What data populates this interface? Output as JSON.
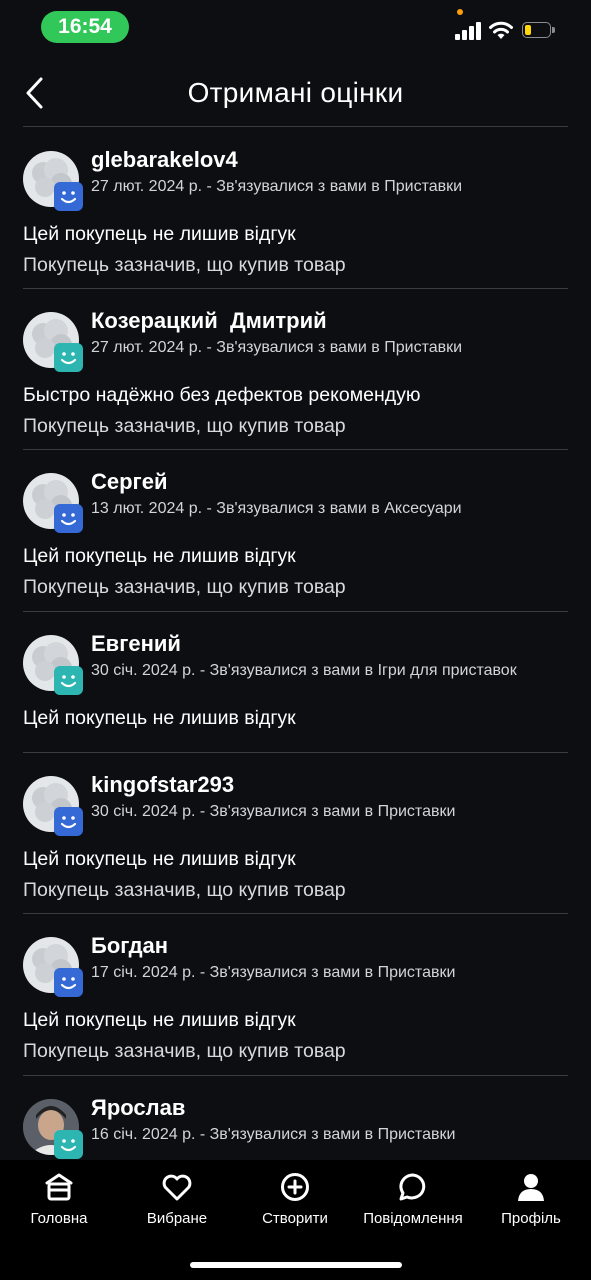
{
  "status_bar": {
    "time": "16:54"
  },
  "header": {
    "title": "Отримані оцінки"
  },
  "reviews": [
    {
      "name": "glebarakelov4",
      "date": "27 лют. 2024 р.",
      "context": " - Зв'язувалися з вами в Приставки",
      "comment": "Цей покупець не лишив відгук",
      "purchase": "Покупець зазначив, що купив товар"
    },
    {
      "name": "Козерацкий  Дмитрий",
      "date": "27 лют. 2024 р.",
      "context": " - Зв'язувалися з вами в Приставки",
      "comment": "Быстро надёжно без дефектов рекомендую",
      "purchase": "Покупець зазначив, що купив товар"
    },
    {
      "name": "Сергей",
      "date": "13 лют. 2024 р.",
      "context": " - Зв'язувалися з вами в Аксесуари",
      "comment": "Цей покупець не лишив відгук",
      "purchase": "Покупець зазначив, що купив товар"
    },
    {
      "name": "Евгений",
      "date": "30 січ. 2024 р.",
      "context": " - Зв'язувалися з вами в Ігри для приставок",
      "comment": "Цей покупець не лишив відгук",
      "purchase": ""
    },
    {
      "name": "kingofstar293",
      "date": "30 січ. 2024 р.",
      "context": " - Зв'язувалися з вами в Приставки",
      "comment": "Цей покупець не лишив відгук",
      "purchase": "Покупець зазначив, що купив товар"
    },
    {
      "name": "Богдан",
      "date": "17 січ. 2024 р.",
      "context": " - Зв'язувалися з вами в Приставки",
      "comment": "Цей покупець не лишив відгук",
      "purchase": "Покупець зазначив, що купив товар"
    },
    {
      "name": "Ярослав",
      "date": "16 січ. 2024 р.",
      "context": " - Зв'язувалися з вами в Приставки",
      "comment": "",
      "purchase": ""
    }
  ],
  "bottom_nav": {
    "items": [
      {
        "label": "Головна",
        "icon": "home-icon"
      },
      {
        "label": "Вибране",
        "icon": "heart-icon"
      },
      {
        "label": "Створити",
        "icon": "plus-circle-icon"
      },
      {
        "label": "Повідомлення",
        "icon": "chat-bubble-icon"
      },
      {
        "label": "Профіль",
        "icon": "person-icon"
      }
    ]
  },
  "colors": {
    "background": "#0d0e12",
    "badge_blue": "#3469d6",
    "badge_teal": "#2db5b2",
    "status_green": "#32c759"
  }
}
